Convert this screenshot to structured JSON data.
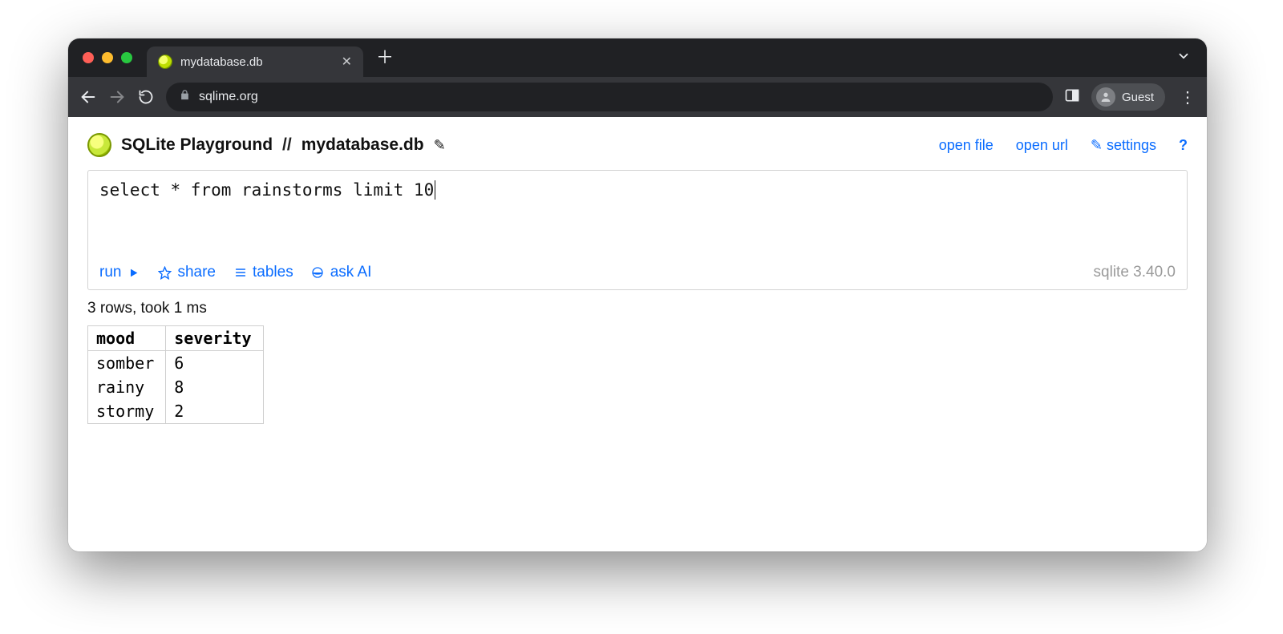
{
  "browser": {
    "tab_title": "mydatabase.db",
    "url_display": "sqlime.org",
    "guest_label": "Guest"
  },
  "app": {
    "title": "SQLite Playground",
    "separator": "//",
    "db_name": "mydatabase.db",
    "links": {
      "open_file": "open file",
      "open_url": "open url",
      "settings": "settings",
      "help": "?"
    }
  },
  "editor": {
    "sql": "select * from rainstorms limit 10",
    "actions": {
      "run": "run",
      "share": "share",
      "tables": "tables",
      "ask_ai": "ask AI"
    },
    "version": "sqlite 3.40.0"
  },
  "results": {
    "status": "3 rows, took 1 ms",
    "columns": [
      "mood",
      "severity"
    ],
    "rows": [
      [
        "somber",
        "6"
      ],
      [
        "rainy",
        "8"
      ],
      [
        "stormy",
        "2"
      ]
    ]
  }
}
